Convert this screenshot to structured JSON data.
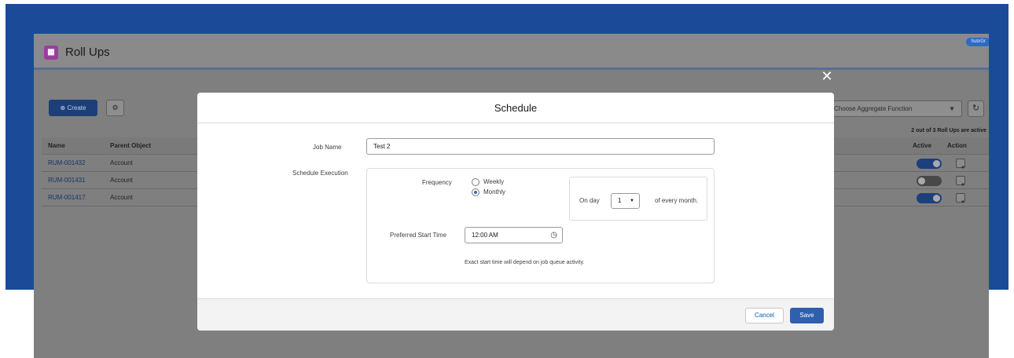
{
  "app": {
    "title": "Roll Ups",
    "logo_text": "▦",
    "badge": "Sub/Gr"
  },
  "background": {
    "create_label": "Create",
    "aggregate_placeholder": "Choose Aggregate Function",
    "active_count": "2 out of 3 Roll Ups are active",
    "columns": {
      "name": "Name",
      "parent": "Parent Object",
      "active": "Active",
      "action": "Action"
    },
    "rows": [
      {
        "name": "RUM-001432",
        "parent": "Account",
        "active": true
      },
      {
        "name": "RUM-001431",
        "parent": "Account",
        "active": false
      },
      {
        "name": "RUM-001417",
        "parent": "Account",
        "active": true
      }
    ]
  },
  "modal": {
    "title": "Schedule",
    "job_name_label": "Job Name",
    "job_name_value": "Test 2",
    "schedule_execution_label": "Schedule Execution",
    "frequency_label": "Frequency",
    "frequency_options": [
      {
        "label": "Weekly",
        "checked": false
      },
      {
        "label": "Monthly",
        "checked": true
      }
    ],
    "on_day_label": "On day",
    "day_value": "1",
    "every_month_label": "of every month.",
    "preferred_start_label": "Preferred Start Time",
    "start_time_value": "12:00 AM",
    "note": "Exact start time will depend on job queue activity.",
    "cancel_label": "Cancel",
    "save_label": "Save",
    "close_symbol": "✕"
  },
  "colors": {
    "brand_blue": "#1b4a99",
    "button_blue": "#2f5fae",
    "link_blue": "#0b5cab"
  }
}
